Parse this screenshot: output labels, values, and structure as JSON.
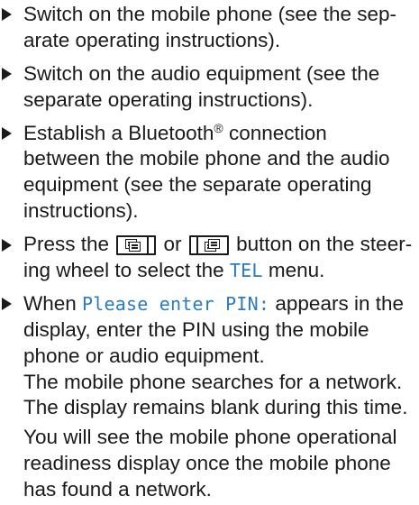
{
  "steps": [
    {
      "lines": [
        "Switch on the mobile phone (see the sep-",
        "arate operating instructions)."
      ]
    },
    {
      "lines": [
        "Switch on the audio equipment (see the",
        "separate operating instructions)."
      ]
    },
    {
      "line1_before": "Establish a Bluetooth",
      "line1_reg": "®",
      "line1_after": " connection",
      "lines": [
        "between the mobile phone and the audio",
        "equipment (see the separate operating",
        "instructions)."
      ]
    },
    {
      "line1_part1": "Press the ",
      "line1_part2": " or ",
      "line1_part3": " button on the steer-",
      "line2_part1": "ing wheel to select the ",
      "line2_tel": "TEL",
      "line2_part2": " menu.",
      "button_left_icon": "page-back-icon",
      "button_right_icon": "page-forward-icon"
    },
    {
      "line1_part1": "When ",
      "line1_code": "Please enter PIN:",
      "line1_part2": " appears in the",
      "lines": [
        "display, enter the PIN using the mobile",
        "phone or audio equipment."
      ]
    }
  ],
  "result_lines": [
    "The mobile phone searches for a network.",
    "The display remains blank during this time."
  ],
  "note_lines": [
    "You will see the mobile phone operational",
    "readiness display once the mobile phone",
    "has found a network."
  ],
  "colors": {
    "text": "#1a1a1a",
    "display_text": "#2a7bbf"
  }
}
